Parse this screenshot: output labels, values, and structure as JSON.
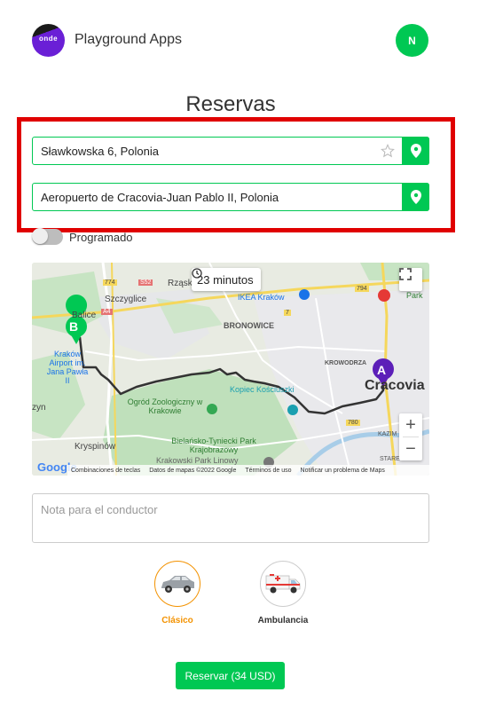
{
  "header": {
    "logo_text": "onde",
    "app_name": "Playground Apps",
    "avatar_initial": "N"
  },
  "title": "Reservas",
  "origin": {
    "value": "Sławkowska 6, Polonia",
    "icon": "map-pin-icon"
  },
  "destination": {
    "value": "Aeropuerto de Cracovia-Juan Pablo II, Polonia",
    "icon": "map-pin-icon"
  },
  "scheduled": {
    "label": "Programado",
    "enabled": false
  },
  "map": {
    "duration": "23 minutos",
    "markers": {
      "start": "A",
      "end": "B"
    },
    "labels": {
      "rzask": "Rząsk",
      "szczyglice": "Szczyglice",
      "balice": "Balice",
      "bronowice": "BRONOWICE",
      "ikea": "IKEA Kraków",
      "krowodrza": "KROWODRZA",
      "krakow_airport": "Kraków Airport im. Jana Pawła II",
      "kopiec": "Kopiec Kościuszki",
      "zoo": "Ogród Zoologiczny w Krakowie",
      "cracovia": "Cracovia",
      "krzyn": "zyn",
      "kryspinow": "Kryspinów",
      "bielany": "Bielańsko-Tyniecki Park Krajobrazowy",
      "park_linowy": "Krakowski Park Linowy",
      "park": "Park",
      "kazim": "KAZIM",
      "stare": "STARE",
      "road_774": "774",
      "road_s52": "S52",
      "road_794": "794",
      "road_a4": "A4",
      "road_780": "780",
      "road_7": "7"
    },
    "attribution": {
      "google": "Google",
      "shortcuts": "Combinaciones de teclas",
      "data": "Datos de mapas ©2022 Google",
      "terms": "Términos de uso",
      "report": "Notificar un problema de Maps"
    }
  },
  "note": {
    "placeholder": "Nota para el conductor"
  },
  "vehicles": [
    {
      "label": "Clásico",
      "selected": true
    },
    {
      "label": "Ambulancia",
      "selected": false
    }
  ],
  "reserve_button": "Reservar (34 USD)",
  "colors": {
    "accent": "#00c853",
    "highlight": "#e00000",
    "selected": "#f39200"
  }
}
